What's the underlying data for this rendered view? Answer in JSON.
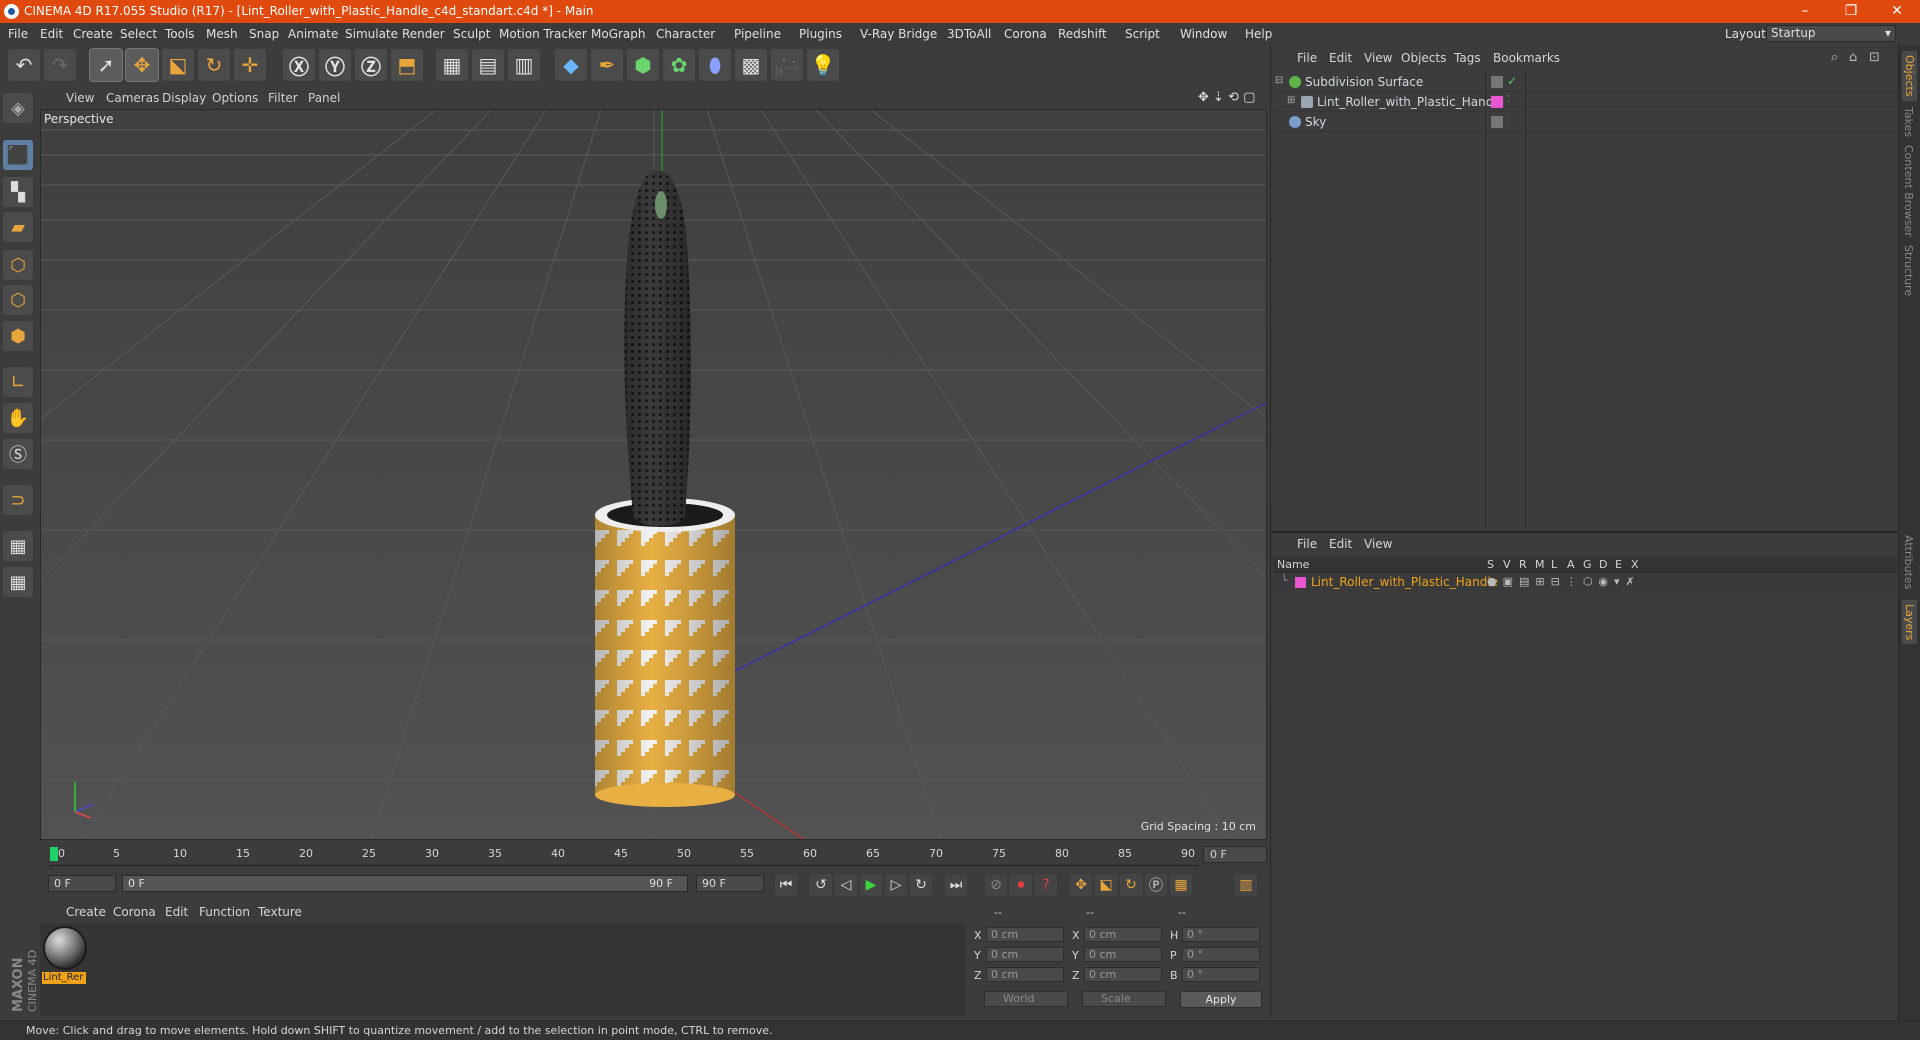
{
  "window": {
    "title": "CINEMA 4D R17.055 Studio (R17) - [Lint_Roller_with_Plastic_Handle_c4d_standart.c4d *] - Main",
    "minimize": "–",
    "maximize": "❐",
    "close": "✕"
  },
  "menu": [
    "File",
    "Edit",
    "Create",
    "Select",
    "Tools",
    "Mesh",
    "Snap",
    "Animate",
    "Simulate",
    "Render",
    "Sculpt",
    "Motion Tracker",
    "MoGraph",
    "Character",
    "Pipeline",
    "Plugins",
    "V-Ray Bridge",
    "3DToAll",
    "Corona",
    "Redshift",
    "Script",
    "Window",
    "Help"
  ],
  "layout": {
    "label": "Layout:",
    "value": "Startup"
  },
  "viewport": {
    "menu": [
      "View",
      "Cameras",
      "Display",
      "Options",
      "Filter",
      "Panel"
    ],
    "label": "Perspective",
    "grid_spacing": "Grid Spacing : 10 cm"
  },
  "timeline": {
    "ticks": [
      "0",
      "5",
      "10",
      "15",
      "20",
      "25",
      "30",
      "35",
      "40",
      "45",
      "50",
      "55",
      "60",
      "65",
      "70",
      "75",
      "80",
      "85",
      "90"
    ],
    "current_frame": "0 F",
    "start_field": "0 F",
    "range_start": "0 F",
    "range_end": "90 F",
    "end_field": "90 F"
  },
  "material_manager": {
    "menu": [
      "Create",
      "Corona",
      "Edit",
      "Function",
      "Texture"
    ],
    "material_name": "Lint_Rer"
  },
  "maxon_logo": "MAXON CINEMA 4D",
  "coordinates": {
    "header": [
      "--",
      "--",
      "--"
    ],
    "rows": [
      {
        "l1": "X",
        "v1": "0 cm",
        "l2": "X",
        "v2": "0 cm",
        "l3": "H",
        "v3": "0 °"
      },
      {
        "l1": "Y",
        "v1": "0 cm",
        "l2": "Y",
        "v2": "0 cm",
        "l3": "P",
        "v3": "0 °"
      },
      {
        "l1": "Z",
        "v1": "0 cm",
        "l2": "Z",
        "v2": "0 cm",
        "l3": "B",
        "v3": "0 °"
      }
    ],
    "mode": "World",
    "transform": "Scale",
    "apply": "Apply"
  },
  "status": "Move: Click and drag to move elements. Hold down SHIFT to quantize movement / add to the selection in point mode, CTRL to remove.",
  "objects": {
    "menu": [
      "File",
      "Edit",
      "View",
      "Objects",
      "Tags",
      "Bookmarks"
    ],
    "items": [
      {
        "name": "Subdivision Surface",
        "icon_color": "#5fb44a"
      },
      {
        "name": "Lint_Roller_with_Plastic_Handle",
        "icon_color": "#9aa7b3"
      },
      {
        "name": "Sky",
        "icon_color": "#7b9dc9"
      }
    ]
  },
  "layers": {
    "menu": [
      "File",
      "Edit",
      "View"
    ],
    "columns": [
      "Name",
      "S",
      "V",
      "R",
      "M",
      "L",
      "A",
      "G",
      "D",
      "E",
      "X"
    ],
    "row_name": "Lint_Roller_with_Plastic_Handle",
    "row_color": "#e855d0"
  },
  "side_tabs": [
    "Objects",
    "Takes",
    "Content Browser",
    "Structure",
    "Attributes",
    "Layers"
  ],
  "colors": {
    "accent": "#e8a53a",
    "title_bar": "#e04a0f",
    "layer_name": "#f0a318"
  }
}
